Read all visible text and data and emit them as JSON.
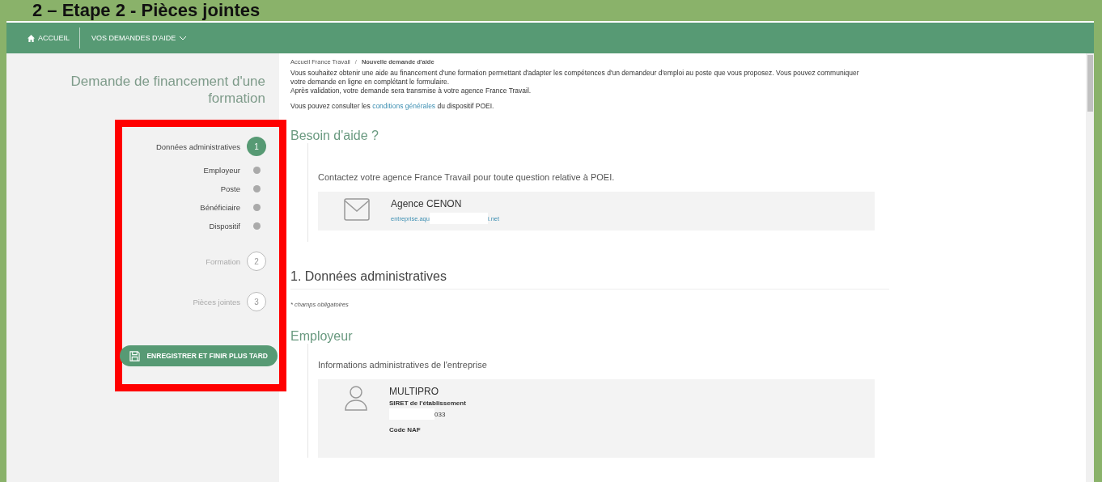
{
  "slide_title": "2 – Etape 2 - Pièces jointes",
  "nav": {
    "items": [
      {
        "label": "ACCUEIL",
        "kind": "home"
      },
      {
        "label": "VOS DEMANDES D'AIDE",
        "kind": "dropdown"
      }
    ]
  },
  "sidebar": {
    "title": "Demande de financement d'une formation",
    "steps": [
      {
        "label": "Données administratives",
        "number": "1",
        "selected": true,
        "children": [
          {
            "label": "Employeur"
          },
          {
            "label": "Poste"
          },
          {
            "label": "Bénéficiaire"
          },
          {
            "label": "Dispositif"
          }
        ]
      },
      {
        "label": "Formation",
        "number": "2",
        "selected": false
      },
      {
        "label": "Pièces jointes",
        "number": "3",
        "selected": false
      }
    ],
    "save_button": "ENREGISTRER ET FINIR PLUS TARD"
  },
  "breadcrumb": [
    "Accueil France Travail",
    "Nouvelle demande d'aide"
  ],
  "breadcrumb_separator": "/",
  "intro": [
    "Vous souhaitez obtenir une aide au financement d'une formation permettant d'adapter les compétences d'un demandeur d'emploi au poste que vous proposez. Vous pouvez communiquer votre demande en ligne en complétant le formulaire.",
    "Après validation, votre demande sera transmise à votre agence France Travail."
  ],
  "conditions": {
    "before": "Vous pouvez consulter les",
    "link": "conditions générales",
    "after": "du dispositif POEI."
  },
  "help": {
    "title": "Besoin d'aide ?",
    "text": "Contactez votre agence France Travail pour toute question relative à POEI.",
    "agency": "Agence CENON",
    "email_start": "entreprise.aqu",
    "email_end": "i.net"
  },
  "section": {
    "title": "1. Données administratives",
    "required_note": "champs obligatoires",
    "required_mark": "*"
  },
  "employer": {
    "title": "Employeur",
    "subtitle": "Informations administratives de l'entreprise",
    "name": "MULTIPRO",
    "siret_label": "SIRET de l'établissement",
    "siret_end": "033",
    "naf_label": "Code NAF"
  }
}
